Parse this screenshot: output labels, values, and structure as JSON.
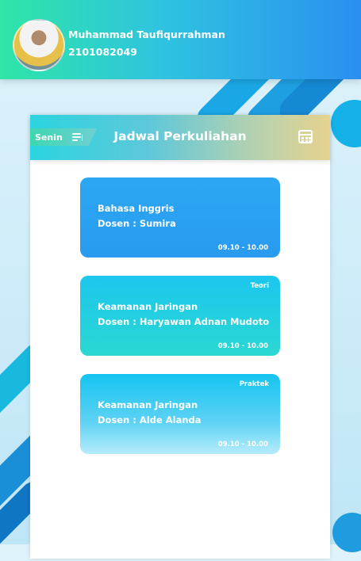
{
  "user": {
    "name": "Muhammad Taufiqurrahman",
    "id": "2101082049"
  },
  "schedule": {
    "title": "Jadwal Perkuliahan",
    "day": "Senin",
    "classes": [
      {
        "subject": "Bahasa Inggris",
        "lecturer": "Dosen : Sumira",
        "time": "09.10 - 10.00",
        "tag": ""
      },
      {
        "subject": "Keamanan Jaringan",
        "lecturer": "Dosen : Haryawan Adnan Mudoto",
        "time": "09.10 - 10.00",
        "tag": "Teori"
      },
      {
        "subject": "Keamanan Jaringan",
        "lecturer": "Dosen : Alde Alanda",
        "time": "09.10 - 10.00",
        "tag": "Praktek"
      }
    ]
  },
  "icons": {
    "sort": "sort-icon",
    "calendar": "calendar-icon"
  },
  "colors": {
    "header_start": "#2ee6a6",
    "header_end": "#2a8ff0",
    "card_blue": "#2ba7f2",
    "card_teal": "#2ad8d2"
  }
}
